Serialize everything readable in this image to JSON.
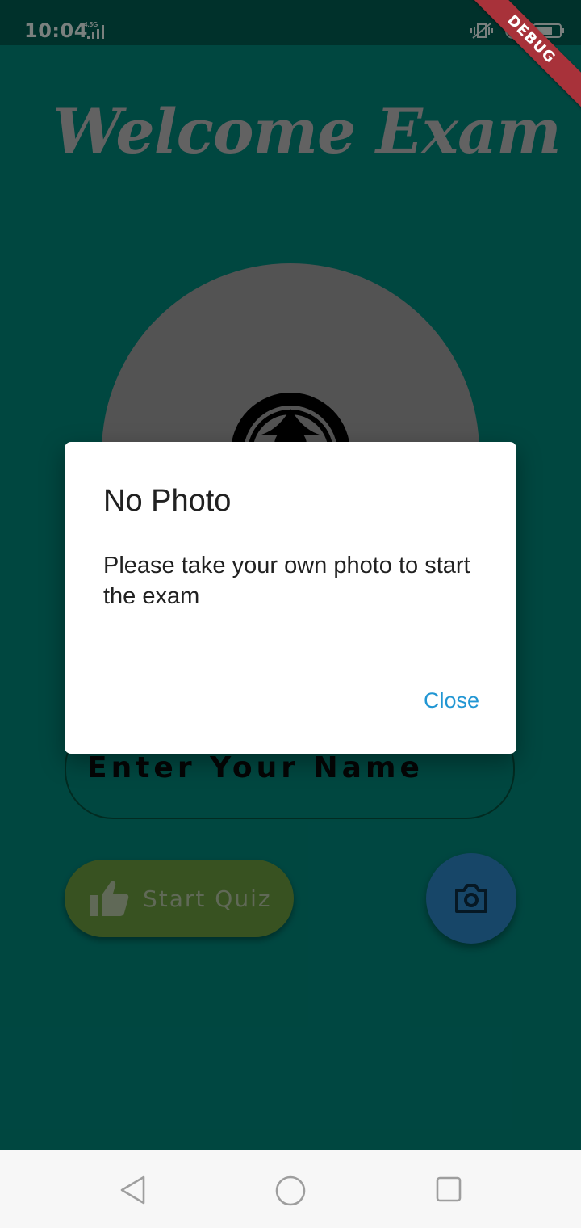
{
  "status_bar": {
    "time": "10:04",
    "network_type": "4.5G",
    "icons": [
      "signal-icon",
      "vibrate-icon",
      "rotation-lock-icon",
      "battery-icon"
    ]
  },
  "debug_banner": "DEBUG",
  "main": {
    "title": "Welcome Exam",
    "name_input": {
      "placeholder": "Enter Your Name",
      "value": ""
    },
    "start_quiz_label": "Start Quiz",
    "avatar_icon": "account-circle-icon",
    "camera_icon": "camera-icon",
    "start_icon": "thumb-up-icon"
  },
  "dialog": {
    "title": "No Photo",
    "message": "Please take your own photo to start the exam",
    "close_label": "Close"
  },
  "nav_bar": {
    "icons": [
      "back-icon",
      "home-icon",
      "recents-icon"
    ]
  },
  "colors": {
    "background": "#00867a",
    "status_bar": "#005d52",
    "start_button": "#6a9b3f",
    "camera_button": "#2c84c4",
    "accent_link": "#2196d3",
    "debug_ribbon": "#a8323a"
  }
}
